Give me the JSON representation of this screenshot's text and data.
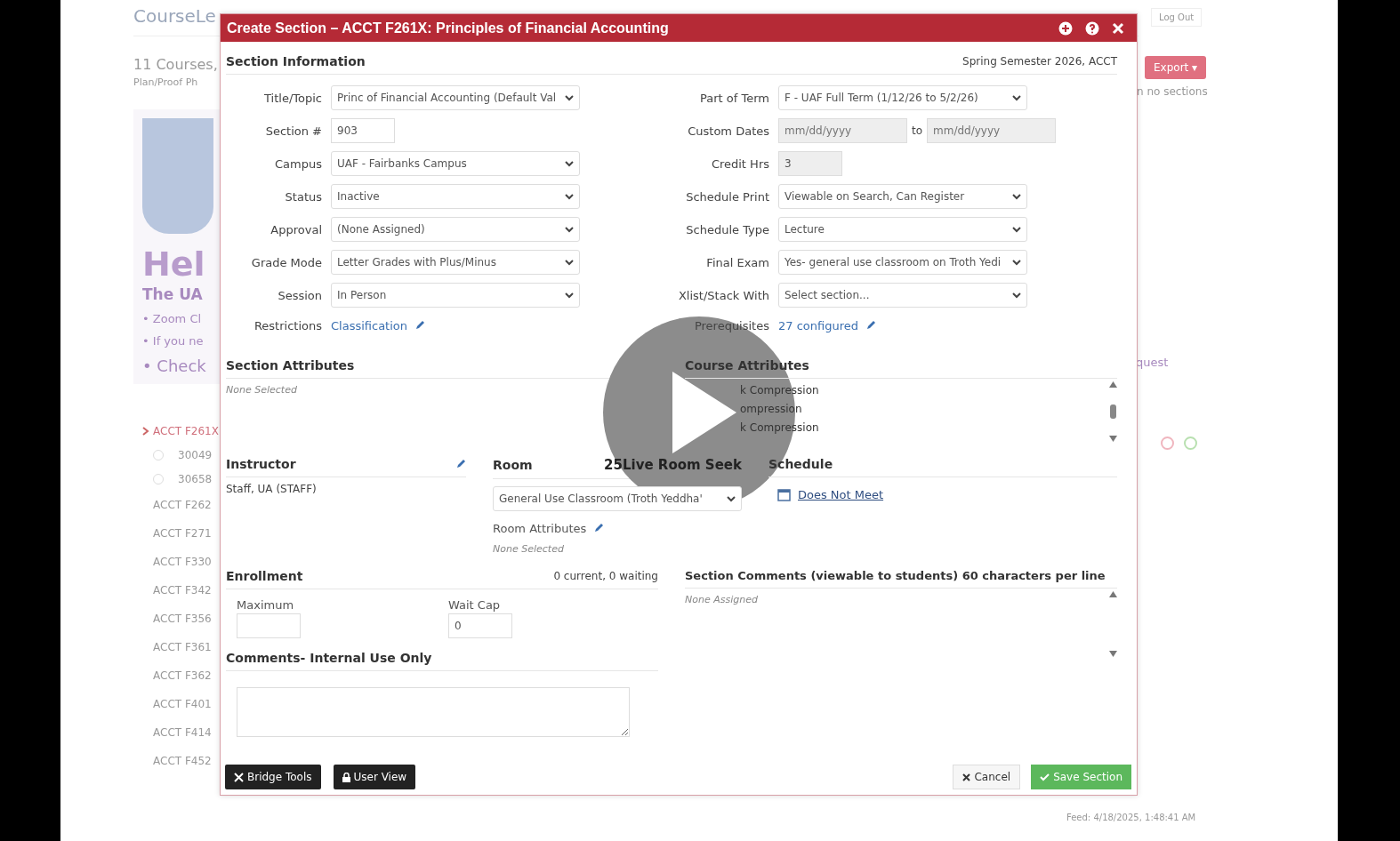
{
  "background": {
    "app_name": "CourseLe",
    "courses_count": "11 Courses,",
    "subtitle": "Plan/Proof Ph",
    "heading": "Hel",
    "subheading": "The UA",
    "bullets": [
      "• Zoom Cl",
      "• If you ne"
    ],
    "bullet_large": "• Check",
    "log_out": "Log Out",
    "export": "Export ▾",
    "no_sections": "n no sections",
    "request": "quest",
    "timestamp": "Feed: 4/18/2025, 1:48:41 AM",
    "courses": [
      {
        "code": "ACCT F261X",
        "expanded": true,
        "sections": [
          {
            "number": "30049",
            "checked": false
          },
          {
            "number": "30658",
            "checked": false
          }
        ]
      },
      {
        "code": "ACCT F262",
        "expanded": false
      },
      {
        "code": "ACCT F271",
        "expanded": false
      },
      {
        "code": "ACCT F330",
        "expanded": false
      },
      {
        "code": "ACCT F342",
        "expanded": false
      },
      {
        "code": "ACCT F356",
        "expanded": false
      },
      {
        "code": "ACCT F361",
        "expanded": false
      },
      {
        "code": "ACCT F362",
        "expanded": false
      },
      {
        "code": "ACCT F401",
        "expanded": false
      },
      {
        "code": "ACCT F414",
        "expanded": false
      },
      {
        "code": "ACCT F452",
        "expanded": false
      }
    ]
  },
  "dialog": {
    "title": "Create Section – ACCT F261X: Principles of Financial Accounting",
    "section_info": "Section Information",
    "term": "Spring Semester 2026, ACCT",
    "left_fields": [
      {
        "label": "Title/Topic",
        "kind": "select",
        "value": "Princ of Financial Accounting (Default Val"
      },
      {
        "label": "Section #",
        "kind": "input",
        "value": "903"
      },
      {
        "label": "Campus",
        "kind": "select",
        "value": "UAF - Fairbanks Campus"
      },
      {
        "label": "Status",
        "kind": "select",
        "value": "Inactive"
      },
      {
        "label": "Approval",
        "kind": "select",
        "value": "(None Assigned)"
      },
      {
        "label": "Grade Mode",
        "kind": "select",
        "value": "Letter Grades with Plus/Minus"
      },
      {
        "label": "Session",
        "kind": "select",
        "value": "In Person"
      },
      {
        "label": "Restrictions",
        "kind": "link",
        "value": "Classification"
      }
    ],
    "right_fields": [
      {
        "label": "Part of Term",
        "kind": "select",
        "value": "F - UAF Full Term (1/12/26 to 5/2/26)"
      },
      {
        "label": "Custom Dates",
        "kind": "dates",
        "placeholder": "mm/dd/yyyy",
        "separator": "to",
        "placeholder_end": "mm/dd/yyyy"
      },
      {
        "label": "Credit Hrs",
        "kind": "readonly",
        "value": "3"
      },
      {
        "label": "Schedule Print",
        "kind": "select",
        "value": "Viewable on Search, Can Register"
      },
      {
        "label": "Schedule Type",
        "kind": "select",
        "value": "Lecture"
      },
      {
        "label": "Final Exam",
        "kind": "select",
        "value": "Yes- general use classroom on Troth Yedi"
      },
      {
        "label": "Xlist/Stack With",
        "kind": "select",
        "value": "Select section..."
      },
      {
        "label": "Prerequisites",
        "kind": "link",
        "value": "27 configured"
      }
    ],
    "section_attributes": {
      "title": "Section Attributes",
      "empty": "None Selected"
    },
    "course_attributes": {
      "title": "Course Attributes",
      "items": [
        "k Compression",
        "ompression",
        "k Compression"
      ]
    },
    "instructor": {
      "title": "Instructor",
      "value": "Staff, UA (STAFF)"
    },
    "room": {
      "title": "Room",
      "seek": "25Live Room Seek",
      "value": "General Use Classroom (Troth Yeddha'",
      "attributes_title": "Room Attributes",
      "attributes_empty": "None Selected"
    },
    "schedule": {
      "title": "Schedule",
      "link": "Does Not Meet"
    },
    "enrollment": {
      "title": "Enrollment",
      "summary": "0 current, 0 waiting",
      "maximum_label": "Maximum",
      "waitcap_label": "Wait Cap",
      "waitcap": "0"
    },
    "section_comments": {
      "title": "Section Comments (viewable to students) 60 characters per line",
      "empty": "None Assigned"
    },
    "internal_comments": {
      "title": "Comments- Internal Use Only"
    },
    "buttons": {
      "bridge": "Bridge Tools",
      "user_view": "User View",
      "cancel": "Cancel",
      "save": "Save Section"
    }
  }
}
